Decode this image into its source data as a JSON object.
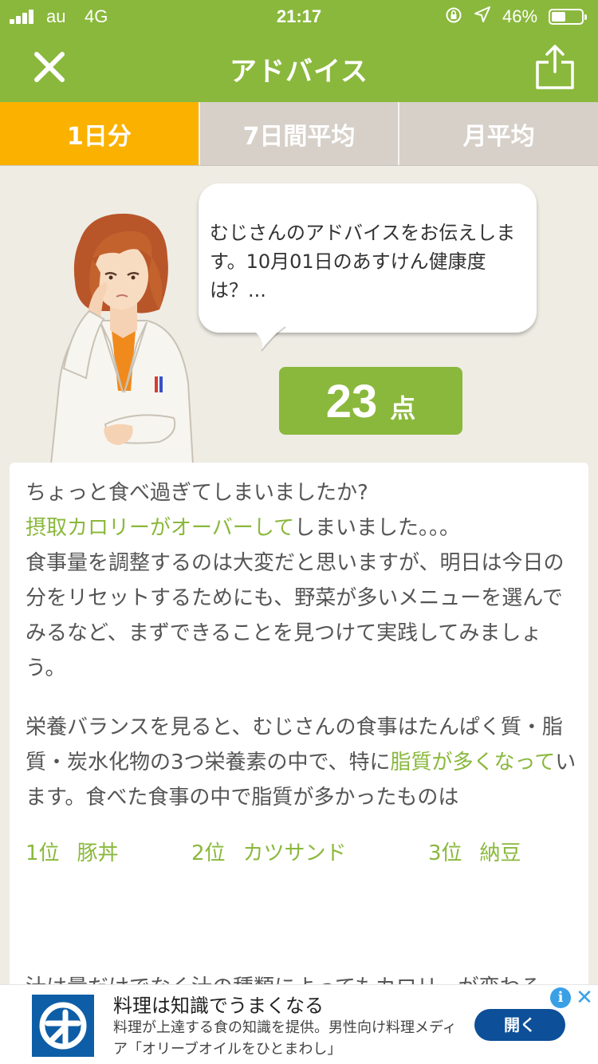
{
  "status_bar": {
    "carrier": "au",
    "network": "4G",
    "time": "21:17",
    "battery_text": "46%",
    "battery_level": 0.46,
    "icons": [
      "signal-icon",
      "rotation-lock-icon",
      "location-icon",
      "battery-icon"
    ]
  },
  "nav": {
    "title": "アドバイス",
    "close_icon": "close-icon",
    "share_icon": "share-icon"
  },
  "tabs": [
    {
      "label": "1日分",
      "active": true
    },
    {
      "label": "7日間平均",
      "active": false
    },
    {
      "label": "月平均",
      "active": false
    }
  ],
  "bubble": {
    "text": "むじさんのアドバイスをお伝えします。10月01日のあすけん健康度は？..."
  },
  "score": {
    "value": "23",
    "unit": "点"
  },
  "advice": {
    "line1": "ちょっと食べ過ぎてしまいましたか?",
    "line2_highlight": "摂取カロリーがオーバーして",
    "line2_rest": "しまいました。。。",
    "para1": "食事量を調整するのは大変だと思いますが、明日は今日の分をリセットするためにも、野菜が多いメニューを選んでみるなど、まずできることを見つけて実践してみましょう。",
    "para2_a": "栄養バランスを見ると、むじさんの食事はたんぱく質・脂質・炭水化物の3つ栄養素の中で、特に",
    "para2_highlight": "脂質が多くなって",
    "para2_b": "います。食べた食事の中で脂質が多かったものは",
    "ranking": [
      {
        "rank": "1位",
        "food": "豚丼"
      },
      {
        "rank": "2位",
        "food": "カツサンド"
      },
      {
        "rank": "3位",
        "food": "納豆"
      }
    ],
    "cut_off_line": "汁は量だけでなく汁の種類によってもカロリーが変わる"
  },
  "ad": {
    "title": "料理は知識でうまくなる",
    "description": "料理が上達する食の知識を提供。男性向け料理メディア「オリーブオイルをひとまわし」",
    "button": "開く",
    "info_icon": "i",
    "close_icon": "✕",
    "colors": {
      "brand": "#0d5ea6",
      "button": "#0d4f98"
    }
  },
  "colors": {
    "primary_green": "#8ab83c",
    "tab_active": "#fbb100",
    "tab_inactive": "#d6d0c9",
    "background": "#efece4"
  }
}
